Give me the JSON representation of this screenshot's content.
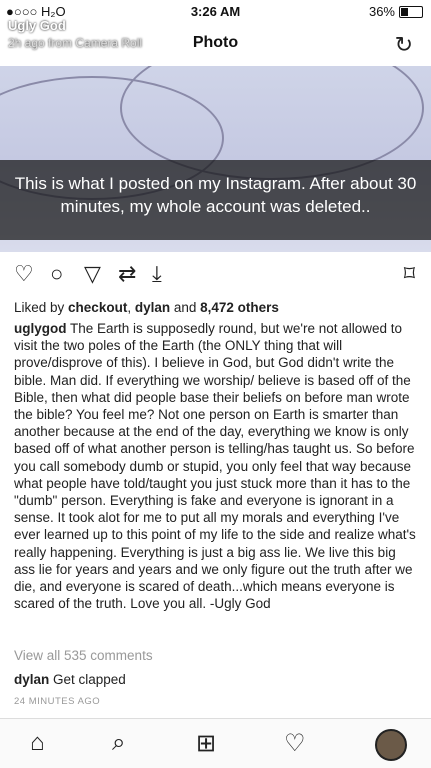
{
  "status": {
    "carrier": "●○○○ H₂O",
    "time": "3:26 AM",
    "battery": "36%",
    "battery_level": 0.36
  },
  "snap": {
    "user": "Ugly God",
    "meta": "2h ago from Camera Roll"
  },
  "nav": {
    "title": "Photo",
    "refresh_icon": "refresh-icon"
  },
  "photo": {
    "caption": "This is what I posted on my Instagram. After about 30 minutes, my whole account was deleted.."
  },
  "actions": {
    "like_icon": "heart-icon",
    "comment_icon": "comment-icon",
    "share_icon": "send-icon",
    "repost_icon": "repost-icon",
    "download_icon": "download-icon",
    "save_icon": "bookmark-icon"
  },
  "likes": {
    "prefix": "Liked by ",
    "user1": "checkout",
    "sep1": ", ",
    "user2": "dylan",
    "sep2": " and ",
    "count": "8,472 others"
  },
  "post": {
    "author": "uglygod",
    "text": " The Earth is supposedly round, but we're not allowed to visit the two poles of the Earth (the ONLY thing that will prove/disprove of this). I believe in God, but God didn't write the bible. Man did. If everything we worship/ believe is based off of the Bible, then what did people base their beliefs on before man wrote the bible? You feel me? Not one person on Earth is smarter than another because at the end of the day, everything we know is only based off of what another person is telling/has taught us. So before you call somebody dumb or stupid, you only feel that way because what people have told/taught you just stuck more than it has to the \"dumb\" person. Everything is fake and everyone is ignorant in a sense. It took alot for me to put all my morals and everything I've ever learned up to this point of my life to the side and realize what's really happening. Everything is just a big ass lie. We live this big ass lie for years and years and we only figure out the truth after we die, and everyone is scared of death...which means everyone is scared of the truth. Love you all. -Ugly God"
  },
  "comments": {
    "view_all": "View all 535 comments",
    "first_user": "dylan",
    "first_text": " Get clapped",
    "time_ago": "24 MINUTES AGO"
  },
  "tabbar": {
    "home": "home-icon",
    "search": "search-icon",
    "add": "add-icon",
    "activity": "heart-icon",
    "profile": "profile-avatar"
  }
}
